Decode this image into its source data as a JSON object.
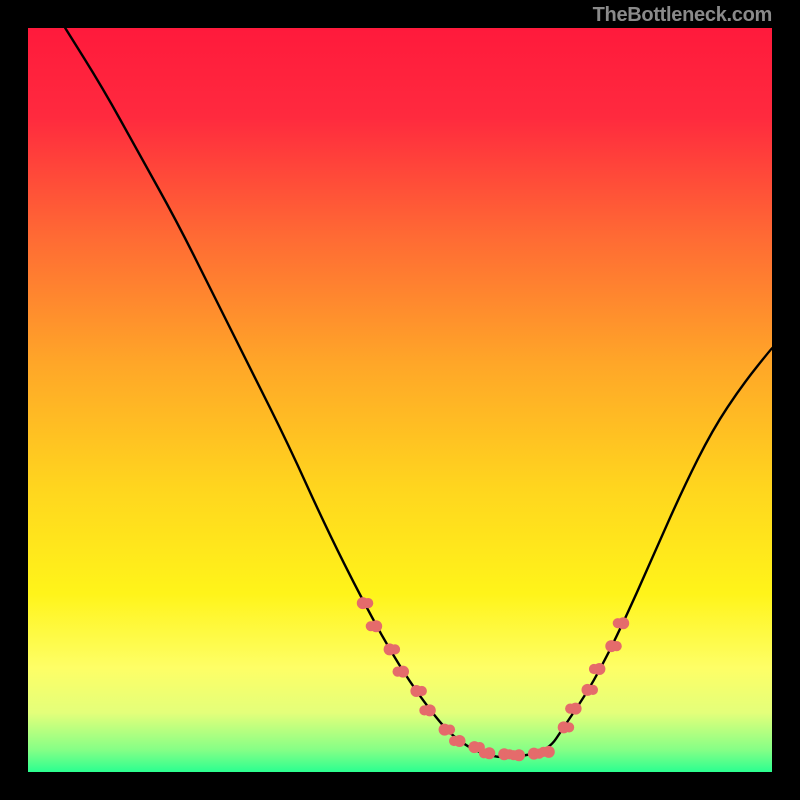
{
  "attribution": "TheBottleneck.com",
  "chart_data": {
    "type": "line",
    "title": "",
    "xlabel": "",
    "ylabel": "",
    "xlim": [
      0,
      100
    ],
    "ylim": [
      0,
      100
    ],
    "background_gradient": {
      "stops": [
        {
          "offset": 0.0,
          "color": "#ff1a3c"
        },
        {
          "offset": 0.12,
          "color": "#ff2a3e"
        },
        {
          "offset": 0.28,
          "color": "#ff6a34"
        },
        {
          "offset": 0.45,
          "color": "#ffa628"
        },
        {
          "offset": 0.62,
          "color": "#ffd61e"
        },
        {
          "offset": 0.76,
          "color": "#fff41a"
        },
        {
          "offset": 0.86,
          "color": "#feff66"
        },
        {
          "offset": 0.92,
          "color": "#e4ff7a"
        },
        {
          "offset": 0.97,
          "color": "#86ff86"
        },
        {
          "offset": 1.0,
          "color": "#2bff90"
        }
      ]
    },
    "curve": {
      "x": [
        5,
        10,
        15,
        20,
        25,
        30,
        35,
        40,
        45,
        50,
        55,
        58,
        62,
        66,
        70,
        72,
        76,
        80,
        84,
        88,
        92,
        96,
        100
      ],
      "y": [
        100,
        92,
        83,
        74,
        64,
        54,
        44,
        33,
        23,
        14,
        7,
        4,
        2,
        2,
        3,
        6,
        12,
        20,
        29,
        38,
        46,
        52,
        57
      ],
      "stroke": "#000000",
      "stroke_width": 2.4
    },
    "markers": {
      "color": "#e56b6b",
      "radius_base": 6,
      "clusters": [
        {
          "x_range": [
            45,
            54
          ],
          "y_range": [
            22,
            8
          ],
          "count": 6
        },
        {
          "x_range": [
            56,
            70
          ],
          "y_range": [
            5,
            2
          ],
          "count": 8
        },
        {
          "x_range": [
            72,
            80
          ],
          "y_range": [
            6,
            20
          ],
          "count": 6
        }
      ]
    }
  }
}
